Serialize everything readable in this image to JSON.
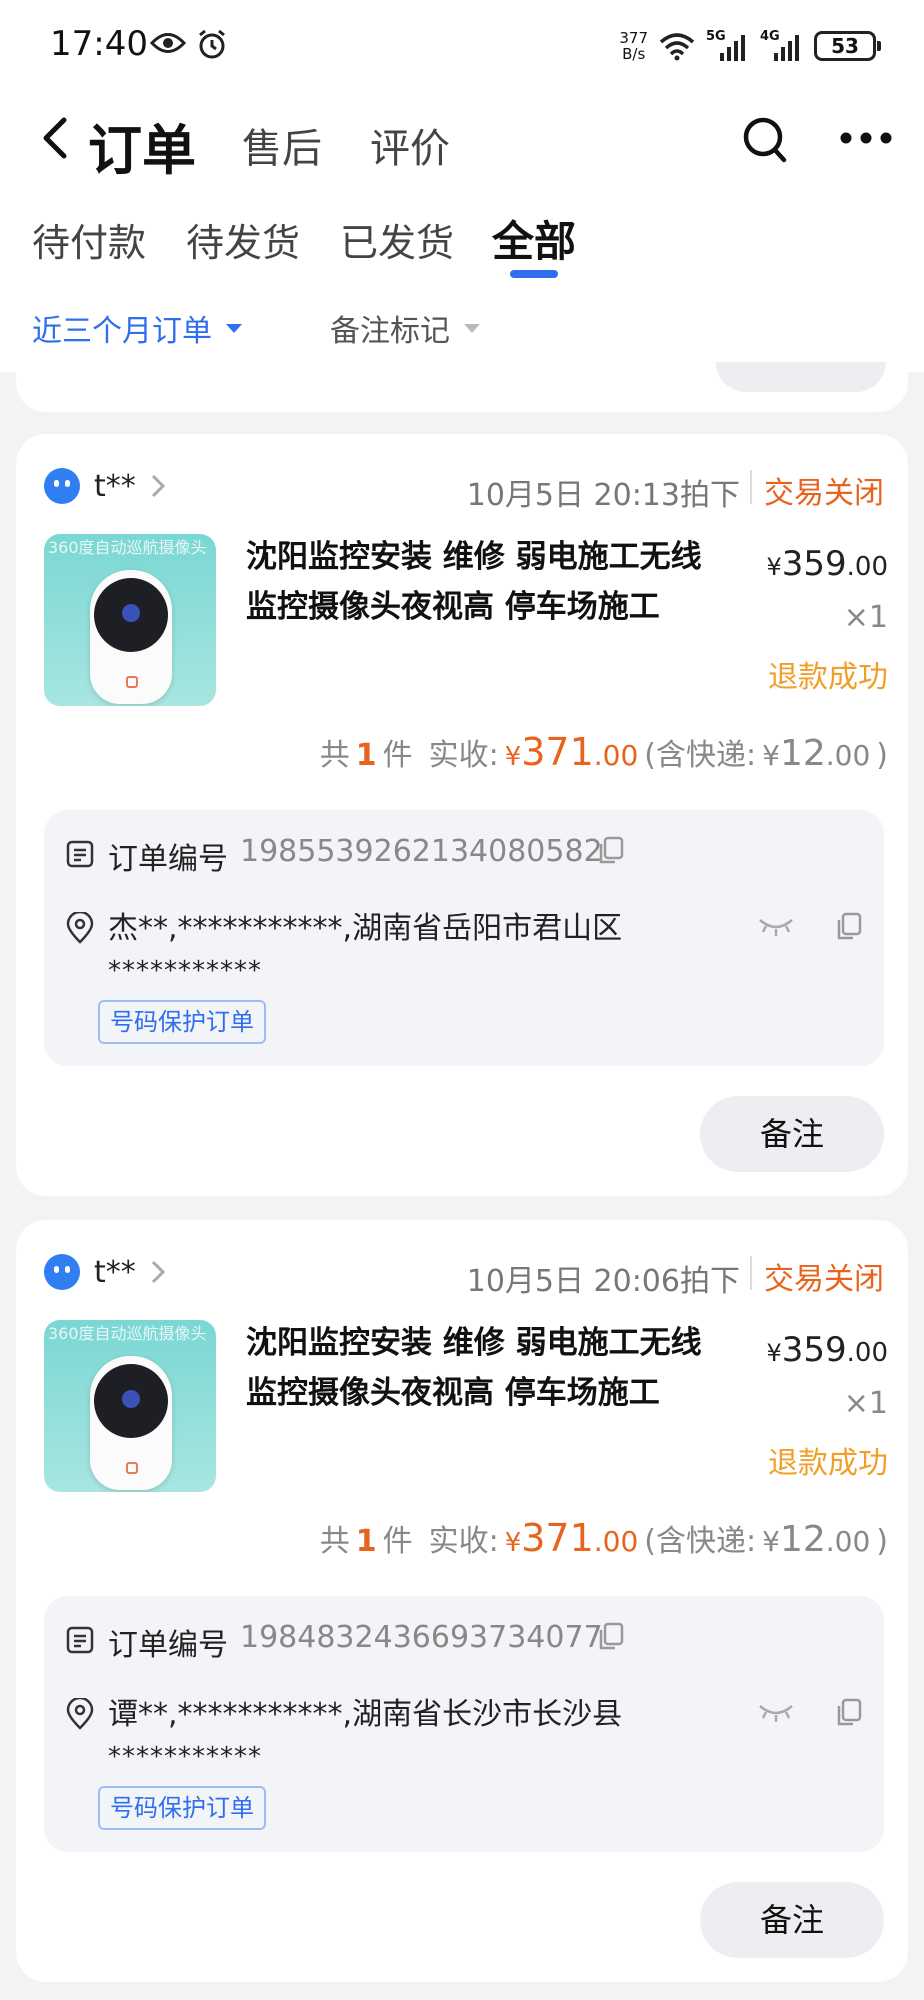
{
  "status_bar": {
    "time": "17:40",
    "net_speed_value": "377",
    "net_speed_unit": "B/s",
    "sig1_label": "5G",
    "sig2_label": "4G",
    "battery": "53"
  },
  "header": {
    "title": "订单",
    "tab_aftersale": "售后",
    "tab_review": "评价"
  },
  "status_tabs": {
    "pending_payment": "待付款",
    "pending_shipment": "待发货",
    "shipped": "已发货",
    "all": "全部"
  },
  "filters": {
    "date_range": "近三个月订单",
    "note_mark": "备注标记"
  },
  "colors": {
    "accent_blue": "#2f6fee",
    "status_orange": "#e8641e",
    "refund_amber": "#f0a02a"
  },
  "orders": [
    {
      "shop_name": "t**",
      "order_time": "10月5日 20:13拍下",
      "status": "交易关闭",
      "thumb_banner": "360度自动巡航摄像头",
      "product_title": "沈阳监控安装 维修  弱电施工无线监控摄像头夜视高 停车场施工",
      "unit_price_currency": "¥",
      "unit_price_int": "359",
      "unit_price_dec": ".00",
      "quantity": "×1",
      "refund_status": "退款成功",
      "summary_count_prefix": "共",
      "summary_count": "1",
      "summary_count_suffix": "件",
      "summary_paid_label": "实收:",
      "paid_currency": "¥",
      "paid_int": "371",
      "paid_dec": ".00",
      "shipping_prefix": "(含快递:",
      "shipping_currency": "¥",
      "shipping_int": "12",
      "shipping_dec": ".00",
      "shipping_suffix": ")",
      "order_no_label": "订单编号",
      "order_no": "1985539262134080582",
      "address": "杰**,***********,湖南省岳阳市君山区",
      "address_mask": "***********",
      "protect_badge": "号码保护订单",
      "note_button": "备注"
    },
    {
      "shop_name": "t**",
      "order_time": "10月5日 20:06拍下",
      "status": "交易关闭",
      "thumb_banner": "360度自动巡航摄像头",
      "product_title": "沈阳监控安装 维修  弱电施工无线监控摄像头夜视高 停车场施工",
      "unit_price_currency": "¥",
      "unit_price_int": "359",
      "unit_price_dec": ".00",
      "quantity": "×1",
      "refund_status": "退款成功",
      "summary_count_prefix": "共",
      "summary_count": "1",
      "summary_count_suffix": "件",
      "summary_paid_label": "实收:",
      "paid_currency": "¥",
      "paid_int": "371",
      "paid_dec": ".00",
      "shipping_prefix": "(含快递:",
      "shipping_currency": "¥",
      "shipping_int": "12",
      "shipping_dec": ".00",
      "shipping_suffix": ")",
      "order_no_label": "订单编号",
      "order_no": "1984832436693734077",
      "address": "谭**,***********,湖南省长沙市长沙县",
      "address_mask": "***********",
      "protect_badge": "号码保护订单",
      "note_button": "备注"
    }
  ]
}
